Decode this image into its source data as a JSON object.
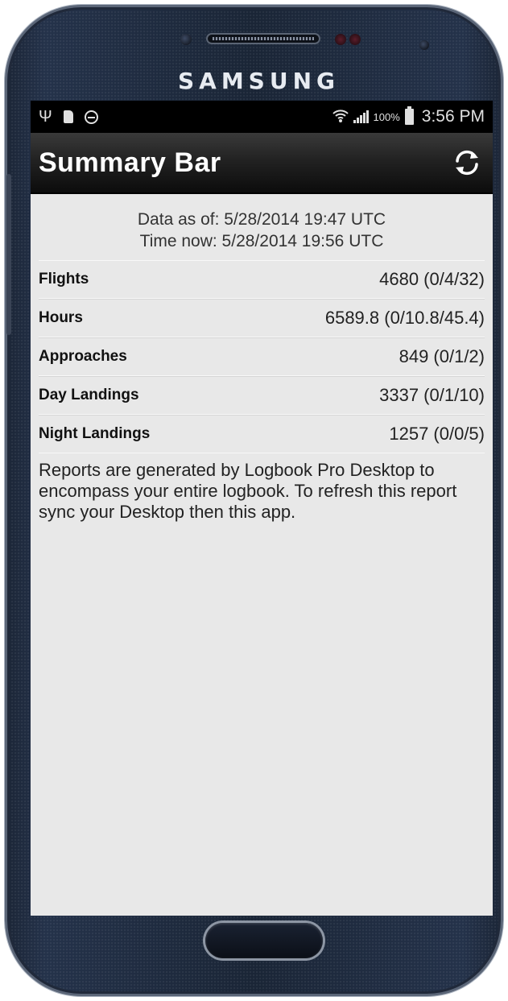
{
  "device": {
    "brand": "SAMSUNG"
  },
  "statusbar": {
    "icons_left": [
      "usb-icon",
      "sd-card-icon",
      "do-not-disturb-icon"
    ],
    "icons_right": [
      "wifi-icon",
      "signal-icon"
    ],
    "battery": "100%",
    "time": "3:56 PM"
  },
  "appbar": {
    "title": "Summary Bar",
    "action_icon": "refresh-icon"
  },
  "summary": {
    "data_as_of": "Data as of: 5/28/2014 19:47 UTC",
    "time_now": "Time now: 5/28/2014 19:56 UTC",
    "rows": [
      {
        "label": "Flights",
        "value": "4680 (0/4/32)"
      },
      {
        "label": "Hours",
        "value": "6589.8 (0/10.8/45.4)"
      },
      {
        "label": "Approaches",
        "value": "849 (0/1/2)"
      },
      {
        "label": "Day Landings",
        "value": "3337 (0/1/10)"
      },
      {
        "label": "Night Landings",
        "value": "1257 (0/0/5)"
      }
    ],
    "note": "Reports are generated by Logbook Pro Desktop to encompass your entire logbook. To refresh this report sync your Desktop then this app."
  }
}
